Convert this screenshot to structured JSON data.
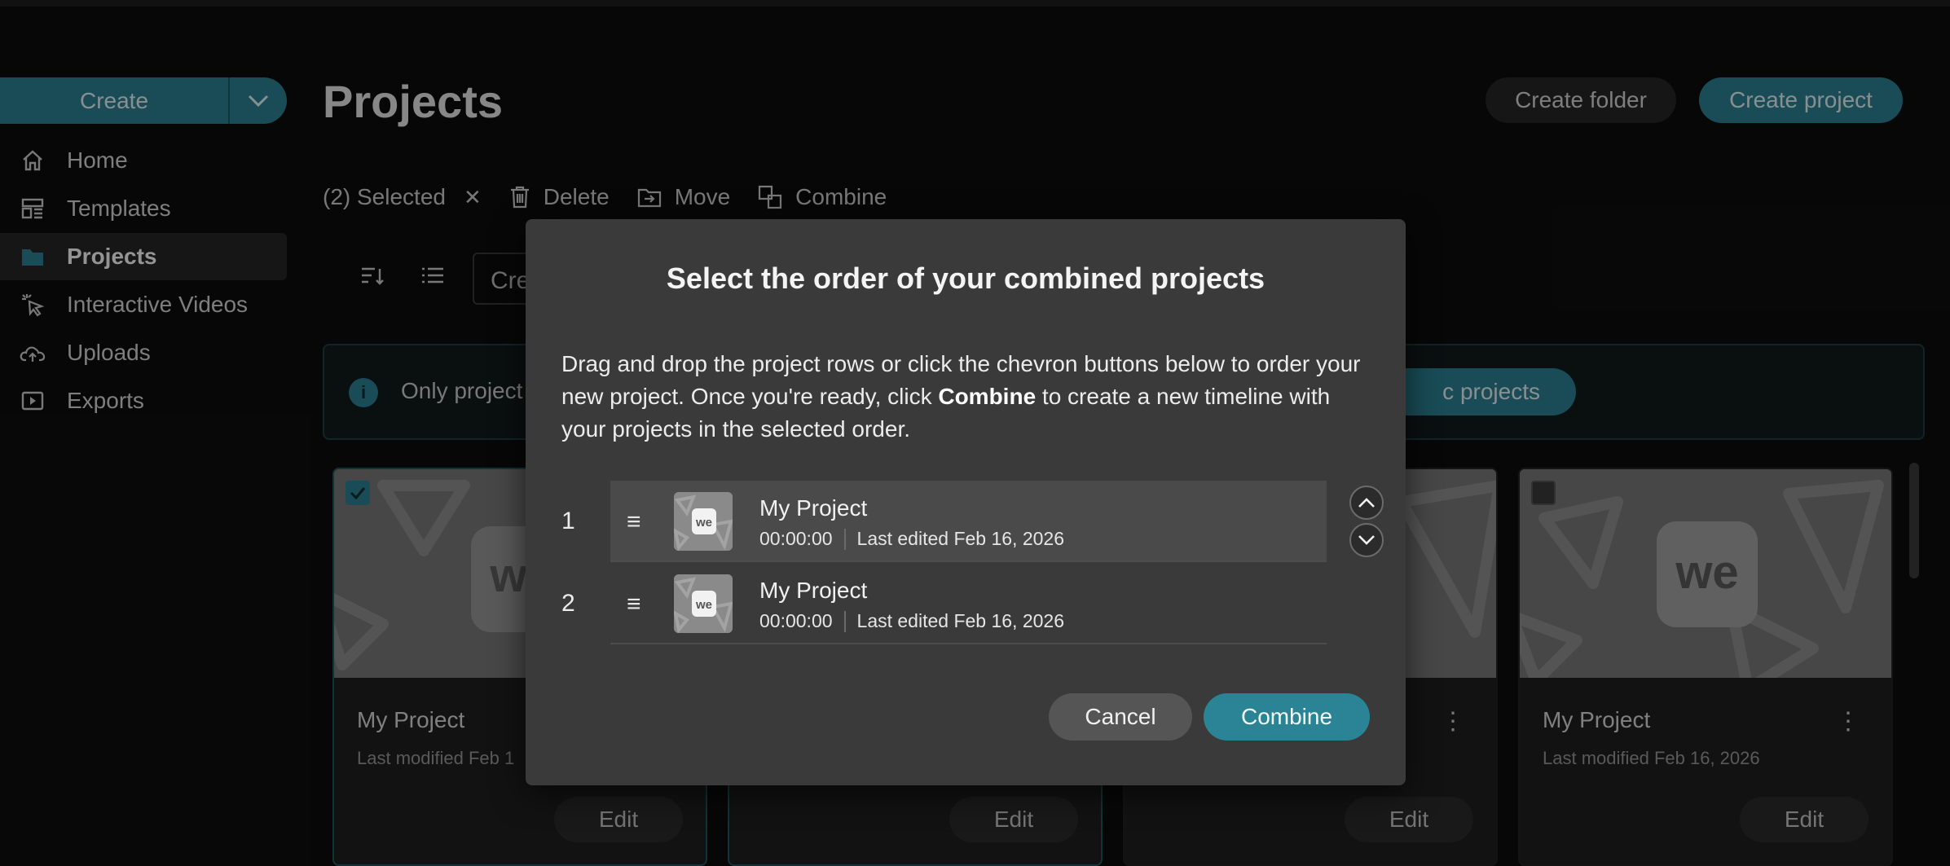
{
  "sidebar": {
    "create_label": "Create",
    "items": [
      {
        "label": "Home",
        "icon": "home-icon"
      },
      {
        "label": "Templates",
        "icon": "templates-icon"
      },
      {
        "label": "Projects",
        "icon": "folder-icon",
        "active": true
      },
      {
        "label": "Interactive Videos",
        "icon": "cursor-click-icon"
      },
      {
        "label": "Uploads",
        "icon": "cloud-upload-icon"
      },
      {
        "label": "Exports",
        "icon": "export-icon"
      }
    ]
  },
  "header": {
    "title": "Projects",
    "create_folder": "Create folder",
    "create_project": "Create project"
  },
  "selection_bar": {
    "selected": "(2) Selected",
    "delete": "Delete",
    "move": "Move",
    "combine": "Combine"
  },
  "search": {
    "value": "Cre"
  },
  "banner": {
    "text": "Only project",
    "button": "c projects"
  },
  "cards": [
    {
      "title": "My Project",
      "subtitle": "Last modified Feb 1",
      "edit": "Edit",
      "checked": true
    },
    {
      "title": "",
      "subtitle": "",
      "edit": "Edit",
      "checked": true
    },
    {
      "title": "",
      "subtitle": "",
      "edit": "Edit",
      "checked": false
    },
    {
      "title": "My Project",
      "subtitle": "Last modified Feb 16, 2026",
      "edit": "Edit",
      "checked": false
    }
  ],
  "modal": {
    "title": "Select the order of your combined projects",
    "desc_part1": "Drag and drop the project rows or click the chevron buttons below to order your new project. Once you're ready, click ",
    "desc_bold": "Combine",
    "desc_part2": " to create a new timeline with your projects in the selected order.",
    "rows": [
      {
        "num": "1",
        "name": "My Project",
        "duration": "00:00:00",
        "edited": "Last edited Feb 16, 2026"
      },
      {
        "num": "2",
        "name": "My Project",
        "duration": "00:00:00",
        "edited": "Last edited Feb 16, 2026"
      }
    ],
    "cancel": "Cancel",
    "combine": "Combine"
  },
  "colors": {
    "accent": "#2b8495",
    "modal_bg": "#3a3a3a",
    "page_bg": "#0d0d0d"
  }
}
